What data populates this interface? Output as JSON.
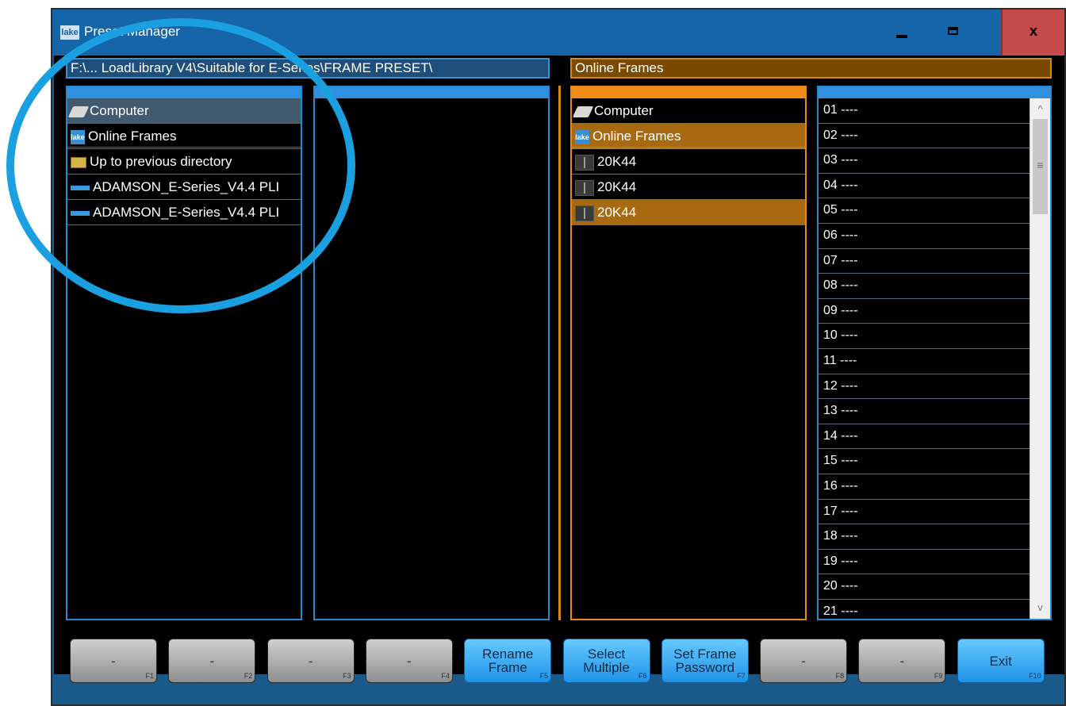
{
  "window": {
    "title": "Preset Manager",
    "app_icon": "lake",
    "controls": [
      "minimize-icon",
      "maximize-icon",
      "close-icon"
    ],
    "close_glyph": "x"
  },
  "left_path": "F:\\... LoadLibrary V4\\Suitable for E-Series\\FRAME PRESET\\",
  "right_title": "Online Frames",
  "left_browser": {
    "items": [
      {
        "label": "Computer",
        "icon": "computer-icon",
        "selected": true
      },
      {
        "label": "Online Frames",
        "icon": "lake-icon"
      },
      {
        "label": "Up to previous directory",
        "icon": "folder-up-icon"
      },
      {
        "label": "ADAMSON_E-Series_V4.4 PLI",
        "icon": "preset-file-icon"
      },
      {
        "label": "ADAMSON_E-Series_V4.4 PLI",
        "icon": "preset-file-icon"
      }
    ]
  },
  "frames_browser": {
    "items": [
      {
        "label": "Computer",
        "icon": "computer-icon"
      },
      {
        "label": "Online Frames",
        "icon": "lake-icon",
        "selected": true
      },
      {
        "label": "20K44",
        "icon": "frame-icon"
      },
      {
        "label": "20K44",
        "icon": "frame-icon"
      },
      {
        "label": "20K44",
        "icon": "frame-icon",
        "selected": true
      }
    ]
  },
  "slots": [
    "01 ----",
    "02 ----",
    "03 ----",
    "04 ----",
    "05 ----",
    "06 ----",
    "07 ----",
    "08 ----",
    "09 ----",
    "10 ----",
    "11 ----",
    "12 ----",
    "13 ----",
    "14 ----",
    "15 ----",
    "16 ----",
    "17 ----",
    "18 ----",
    "19 ----",
    "20 ----",
    "21 ----"
  ],
  "scrollbar": {
    "up": "^",
    "grip": "≡",
    "down": "v"
  },
  "function_keys": [
    {
      "label": "-",
      "key": "F1",
      "enabled": false
    },
    {
      "label": "-",
      "key": "F2",
      "enabled": false
    },
    {
      "label": "-",
      "key": "F3",
      "enabled": false
    },
    {
      "label": "-",
      "key": "F4",
      "enabled": false
    },
    {
      "label": "Rename\nFrame",
      "key": "F5",
      "enabled": true
    },
    {
      "label": "Select\nMultiple",
      "key": "F6",
      "enabled": true
    },
    {
      "label": "Set Frame\nPassword",
      "key": "F7",
      "enabled": true
    },
    {
      "label": "-",
      "key": "F8",
      "enabled": false
    },
    {
      "label": "-",
      "key": "F9",
      "enabled": false
    },
    {
      "label": "Exit",
      "key": "F10",
      "enabled": true
    }
  ],
  "colors": {
    "highlight_ring": "#1aa0e0",
    "accent_blue": "#2f8fe0",
    "accent_orange": "#f08a18"
  }
}
